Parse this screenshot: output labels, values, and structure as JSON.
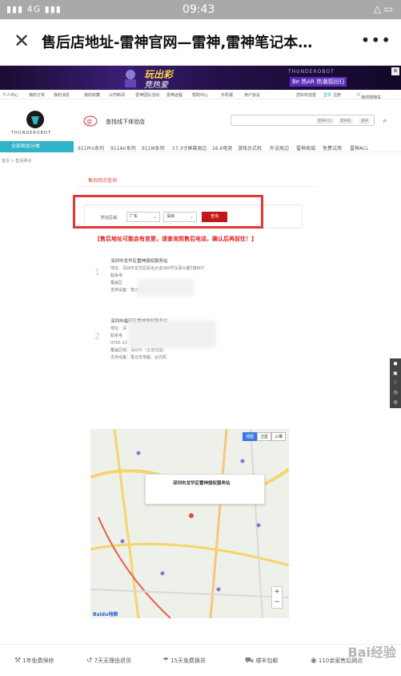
{
  "status_bar": {
    "signal": "4G",
    "time": "09:43"
  },
  "browser": {
    "title": "售后店地址-雷神官网—雷神,雷神笔记本…",
    "more": "•••"
  },
  "banner": {
    "headline": "玩出彩",
    "subline": "竞热爱",
    "brand_text": "THUNDEROBOT",
    "tag": "Be 热AR 热潮感回归"
  },
  "top_nav": [
    "个人中心",
    "我的订单",
    "我的消息",
    "我的收藏",
    "公司新闻",
    "雷神团队活动",
    "雷神远程",
    "帮助中心",
    "手机端",
    "用户协议"
  ],
  "top_nav_right": [
    "您好欢迎雷",
    "登录",
    "注册",
    "我的购物车"
  ],
  "header": {
    "logo_text": "THUNDEROBOT",
    "experience_label": "查找线下体验店",
    "search_tags": [
      "雷神911",
      "雷神机",
      "雷神"
    ]
  },
  "category_nav": {
    "all": "全部商品分类",
    "items": [
      "911Pro系列",
      "911Air系列",
      "911M系列",
      "17.3寸屏幕周边",
      "16.6电竞",
      "游戏台式机",
      "外设周边",
      "雷神商城",
      "免费试用",
      "雷神ACL"
    ]
  },
  "breadcrumb": "首页 > 售后网点",
  "page_title": "售后网点查询",
  "filter": {
    "label": "所在区域：",
    "province": "广东",
    "city": "深圳",
    "button": "查询"
  },
  "notice": "【售后地址可能会有变更，请查询到售后电话，确认后再前往！】",
  "stores": [
    {
      "num": "1",
      "name": "深圳市龙华区雷神授权服务站",
      "address": "地址：深圳市龙华区民治大道390号东源大厦3楼807",
      "contact": "联系电",
      "area": "覆盖区",
      "support": "支持设备：笔记本、台式机"
    },
    {
      "num": "2",
      "name": "深圳市福田区雷神授权服务站",
      "address": "地址：深",
      "contact": "联系电",
      "phone": "0755-23",
      "area": "覆盖区域：深圳市（全境范围）",
      "support": "支持设备：笔记本电脑、台式机"
    }
  ],
  "map": {
    "popup": "深圳市龙华区雷神授权服务站",
    "switch": [
      "地图",
      "卫星",
      "三维"
    ],
    "brand": "Baidu地图",
    "zoom_in": "+",
    "zoom_out": "−"
  },
  "footer": [
    {
      "icon": "wrench",
      "label": "1年免费保修"
    },
    {
      "icon": "return",
      "label": "7天无理由退货"
    },
    {
      "icon": "umbrella",
      "label": "15天免费换货"
    },
    {
      "icon": "truck",
      "label": "顺丰包邮"
    },
    {
      "icon": "pin",
      "label": "110余家售后网点"
    }
  ],
  "watermark": "Bai经验",
  "colors": {
    "accent": "#2fb3c8",
    "danger": "#e53535",
    "button": "#c31818"
  }
}
